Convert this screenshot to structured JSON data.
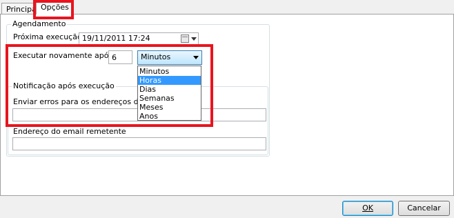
{
  "tabs": [
    {
      "label": "Principal"
    },
    {
      "label": "Opções"
    }
  ],
  "agendamento": {
    "legend": "Agendamento",
    "proxima_label": "Próxima execução",
    "proxima_value": "19/11/2011 17:24",
    "executar_label": "Executar novamente após",
    "executar_value": "6",
    "unit_selected": "Minutos",
    "unit_options": [
      "Minutos",
      "Horas",
      "Dias",
      "Semanas",
      "Meses",
      "Anos"
    ],
    "unit_highlighted": "Horas"
  },
  "notificacao": {
    "legend": "Notificação após execução",
    "erros_label": "Enviar erros para os endereços de em",
    "erros_value": "",
    "remetente_label": "Endereço do email remetente",
    "remetente_value": ""
  },
  "buttons": {
    "ok_label": "OK",
    "cancel_label": "Cancelar"
  },
  "colors": {
    "highlight": "#e8141e",
    "selection": "#3399ff"
  }
}
